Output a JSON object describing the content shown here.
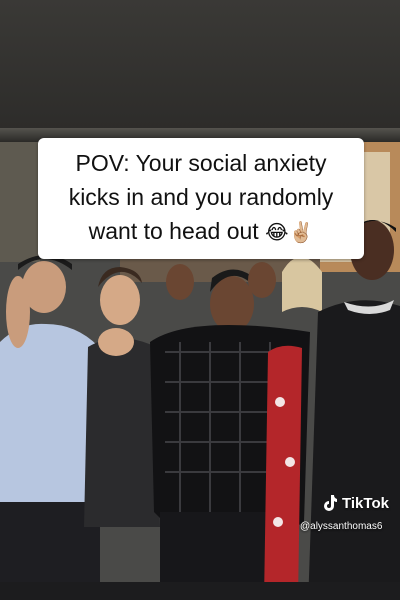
{
  "caption": {
    "line1": "POV: Your social anxiety",
    "line2": "kicks in and you randomly",
    "line3": "want to head out",
    "emoji": "😂✌🏼"
  },
  "watermark": {
    "brand": "TikTok",
    "handle": "@alyssanthomas6",
    "icon": "tiktok-note-icon"
  },
  "photo": {
    "description_icon": "photo-scene"
  }
}
